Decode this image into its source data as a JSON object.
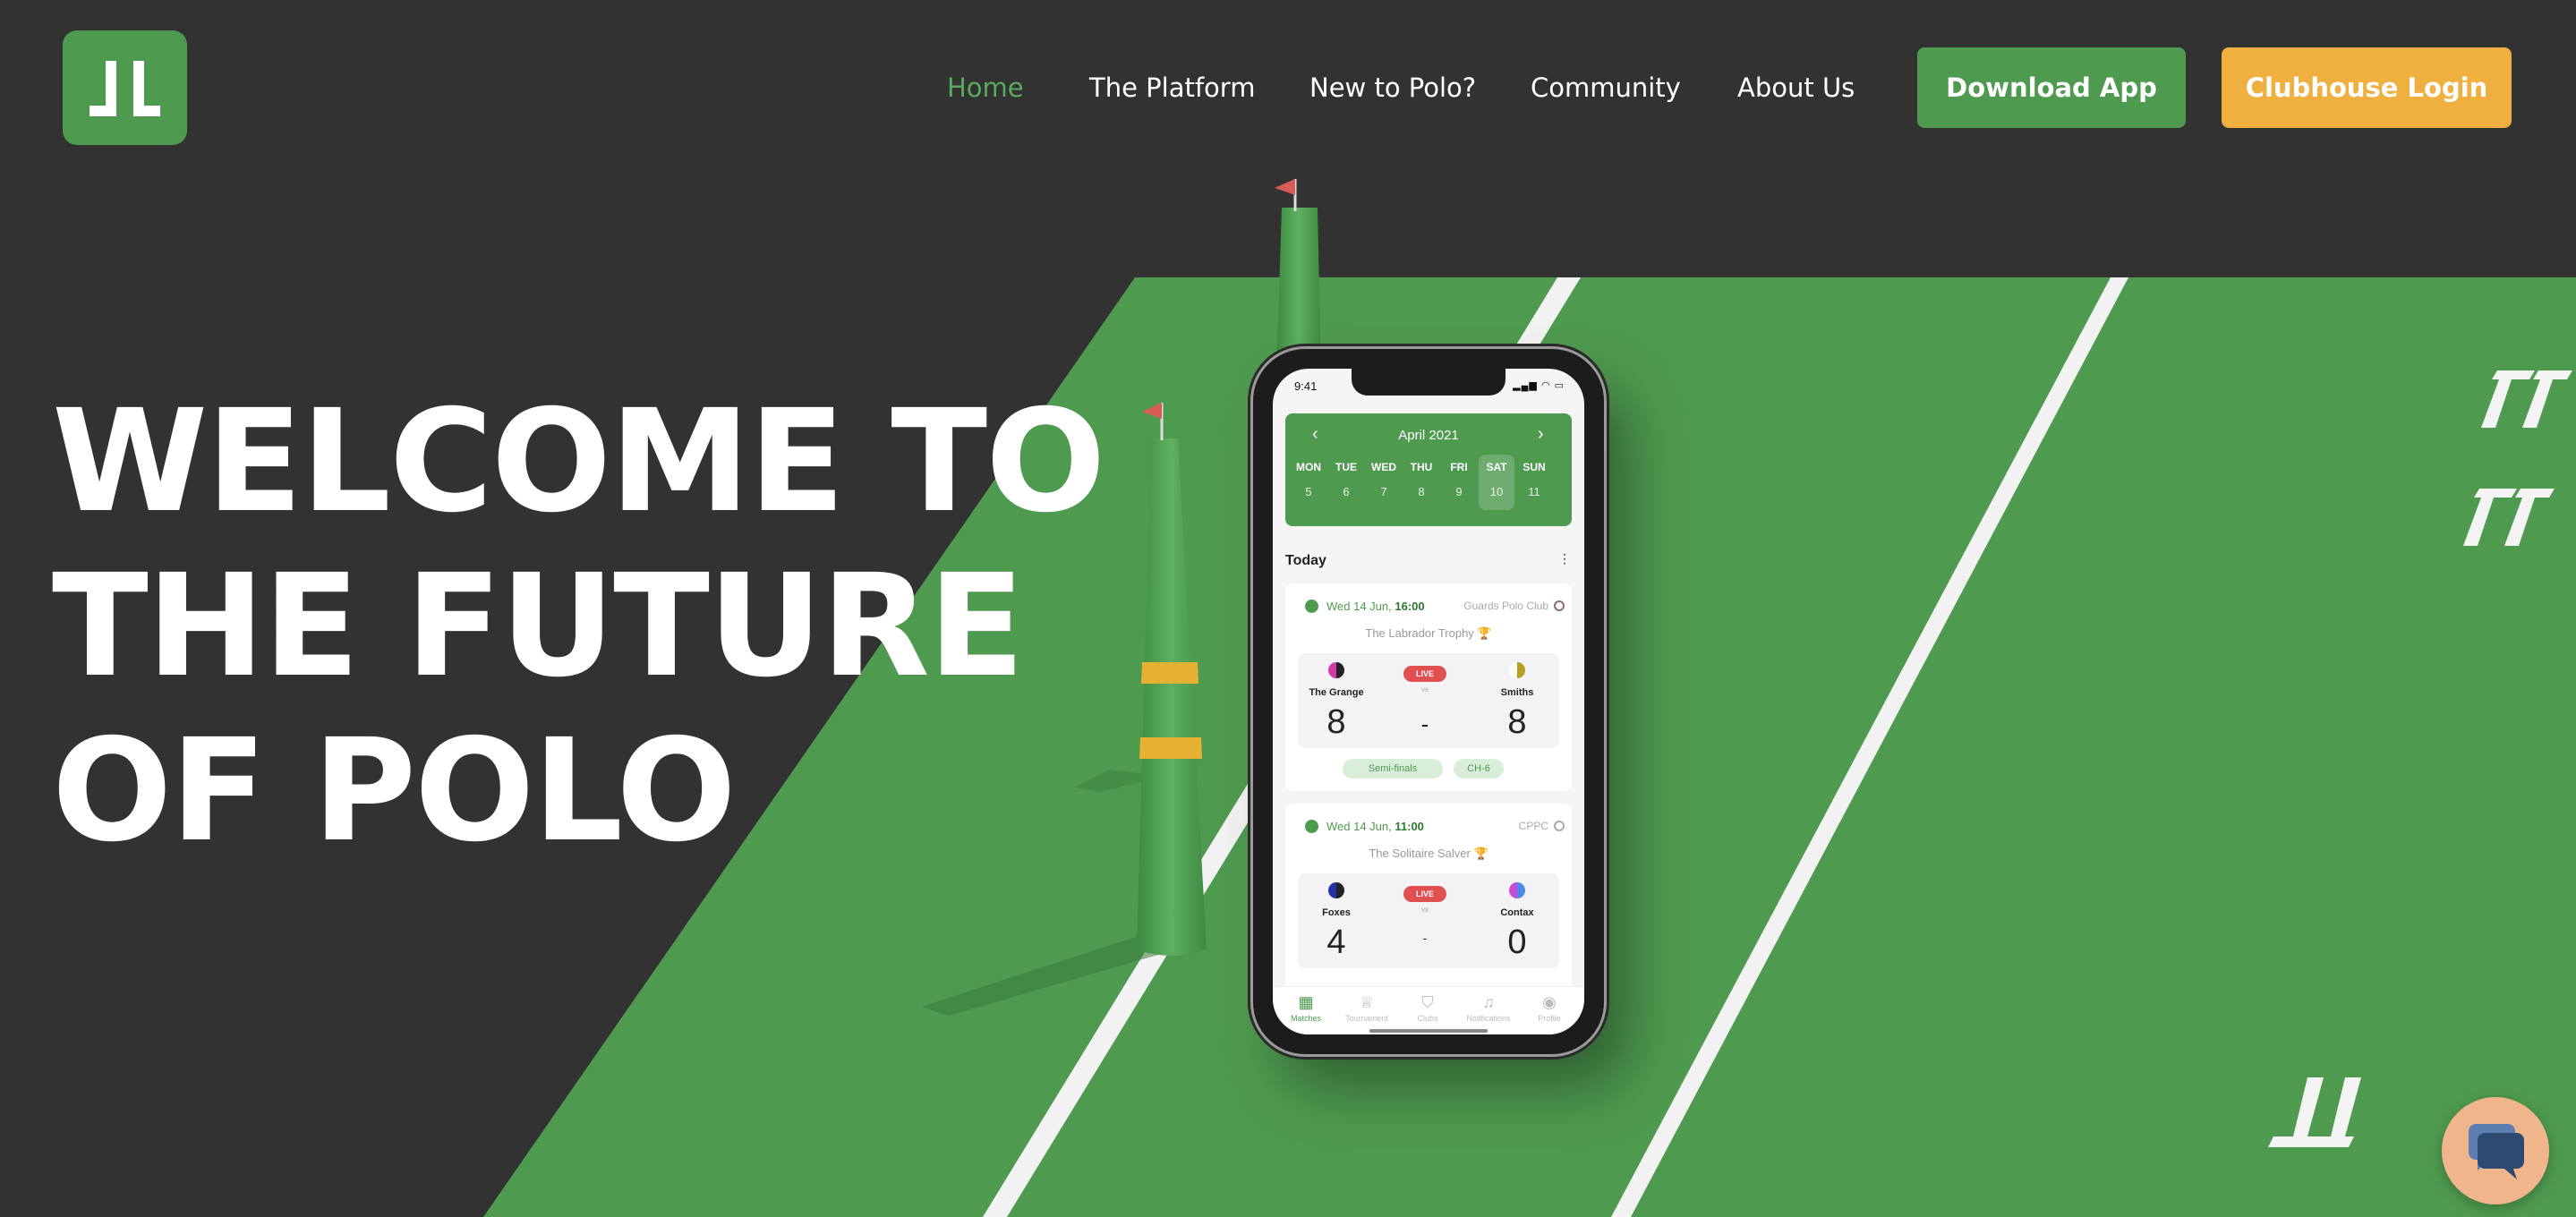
{
  "header": {
    "logo_icon": "jl-logo-icon",
    "nav": [
      {
        "label": "Home",
        "active": true
      },
      {
        "label": "The Platform",
        "active": false
      },
      {
        "label": "New to Polo?",
        "active": false
      },
      {
        "label": "Community",
        "active": false
      },
      {
        "label": "About Us",
        "active": false
      }
    ],
    "download_label": "Download App",
    "login_label": "Clubhouse Login"
  },
  "hero": {
    "line1": "WELCOME TO",
    "line2": "THE FUTURE",
    "line3": "OF POLO"
  },
  "phone": {
    "time": "9:41",
    "calendar": {
      "month": "April 2021",
      "days": [
        {
          "name": "MON",
          "date": "5"
        },
        {
          "name": "TUE",
          "date": "6"
        },
        {
          "name": "WED",
          "date": "7"
        },
        {
          "name": "THU",
          "date": "8"
        },
        {
          "name": "FRI",
          "date": "9"
        },
        {
          "name": "SAT",
          "date": "10"
        },
        {
          "name": "SUN",
          "date": "11"
        }
      ],
      "selected_day": "SAT"
    },
    "section_title": "Today",
    "matches": [
      {
        "date": "Wed 14 Jun, ",
        "time": "16:00",
        "club": "Guards Polo Club",
        "tournament": "The Labrador Trophy",
        "home_team": "The Grange",
        "away_team": "Smiths",
        "home_score": "8",
        "away_score": "8",
        "status": "LIVE",
        "vs": "vs",
        "separator": "-",
        "tags": [
          "Semi-finals",
          "CH-6"
        ]
      },
      {
        "date": "Wed 14 Jun, ",
        "time": "11:00",
        "club": "CPPC",
        "tournament": "The Solitaire Salver",
        "home_team": "Foxes",
        "away_team": "Contax",
        "home_score": "4",
        "away_score": "0",
        "status": "LIVE",
        "vs": "vs",
        "separator": "-",
        "tags": []
      }
    ],
    "tabs": [
      {
        "label": "Matches",
        "icon": "calendar-icon",
        "active": true
      },
      {
        "label": "Tournament",
        "icon": "trophy-icon",
        "active": false
      },
      {
        "label": "Clubs",
        "icon": "shield-icon",
        "active": false
      },
      {
        "label": "Notifications",
        "icon": "bell-icon",
        "active": false
      },
      {
        "label": "Profile",
        "icon": "user-icon",
        "active": false
      }
    ]
  },
  "colors": {
    "background": "#323232",
    "field_green": "#4e9a4f",
    "accent_green": "#5aaa5c",
    "login_yellow": "#efb040",
    "live_red": "#e05050"
  },
  "chat_icon": "chat-bubble-icon"
}
